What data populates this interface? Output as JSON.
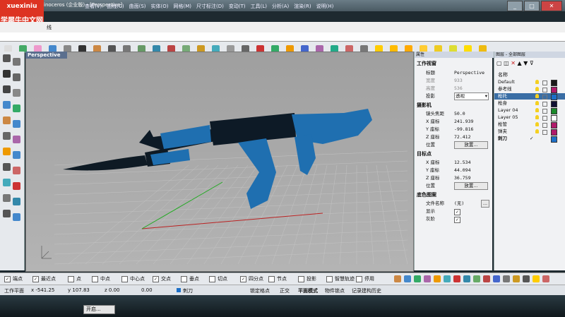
{
  "watermark": {
    "line1": "xuexiniu",
    "line2": "学犀牛中文网"
  },
  "title": {
    "text": "inoceros (企业版) - [Perspective]"
  },
  "menu": [
    "查看(V)",
    "曲线(C)",
    "曲面(S)",
    "实体(O)",
    "网格(M)",
    "尺寸标注(D)",
    "变动(T)",
    "工具(L)",
    "分析(A)",
    "渲染(R)",
    "说明(H)"
  ],
  "command_history": "线",
  "viewport": {
    "tab": "Perspective"
  },
  "properties": {
    "header": "属性",
    "section_viewport": "工作视窗",
    "title_label": "标题",
    "title_value": "Perspective",
    "width_label": "宽度",
    "width_value": "933",
    "height_label": "高度",
    "height_value": "536",
    "projection_label": "投影",
    "projection_value": "透视",
    "section_camera": "摄影机",
    "lens_label": "镜头焦距",
    "lens_value": "50.0",
    "x_label": "X 座标",
    "camera_x": "241.939",
    "y_label": "Y 座标",
    "camera_y": "-99.816",
    "z_label": "Z 座标",
    "camera_z": "72.412",
    "location_label": "位置",
    "place_button": "放置...",
    "section_target": "目标点",
    "target_x": "12.534",
    "target_y": "44.094",
    "target_z": "36.759",
    "section_wallpaper": "底色图案",
    "filename_label": "文件名称",
    "filename_value": "(无)",
    "browse": "...",
    "show_label": "显示",
    "show_checked": true,
    "gray_label": "灰阶",
    "gray_checked": true
  },
  "layers": {
    "header": "图层 - 全部图层",
    "name_header": "名称",
    "items": [
      {
        "name": "Default",
        "color": "#1a1a1a"
      },
      {
        "name": "参考线",
        "color": "#b01a6a"
      },
      {
        "name": "枪托",
        "color": "#1c6fc7",
        "selected": true
      },
      {
        "name": "枪身",
        "color": "#111133"
      },
      {
        "name": "Layer 04",
        "color": "#1a8a2a"
      },
      {
        "name": "Layer 05",
        "color": "#ffffff"
      },
      {
        "name": "枪管",
        "color": "#b01a6a"
      },
      {
        "name": "弹夹",
        "color": "#b01a6a"
      },
      {
        "name": "刺刀",
        "color": "#1c6fc7",
        "current": true
      }
    ]
  },
  "osnap": [
    {
      "label": "端点",
      "checked": true
    },
    {
      "label": "最近点",
      "checked": true
    },
    {
      "label": "点",
      "checked": false
    },
    {
      "label": "中点",
      "checked": false
    },
    {
      "label": "中心点",
      "checked": false
    },
    {
      "label": "交点",
      "checked": true
    },
    {
      "label": "垂点",
      "checked": false
    },
    {
      "label": "切点",
      "checked": false
    },
    {
      "label": "四分点",
      "checked": true
    },
    {
      "label": "节点",
      "checked": false
    },
    {
      "label": "投影",
      "checked": false
    },
    {
      "label": "智慧轨迹",
      "checked": false
    },
    {
      "label": "停用",
      "checked": false
    }
  ],
  "status": {
    "cplane": "工作平面",
    "x": "x -541.25",
    "y": "y 107.83",
    "z": "z 0.00",
    "dist": "0.00",
    "layer": "刺刀",
    "layer_color": "#1c6fc7",
    "grid_snap": "锁定格点",
    "ortho": "正交",
    "planar": "平面模式",
    "osnap": "物件锁点",
    "history": "记录建构历史"
  },
  "taskbar": {
    "button": "开启..."
  },
  "colors": {
    "gun_blue": "#1f6fb0",
    "gun_dark": "#0d1a26",
    "accent": "#5b6f8e"
  }
}
